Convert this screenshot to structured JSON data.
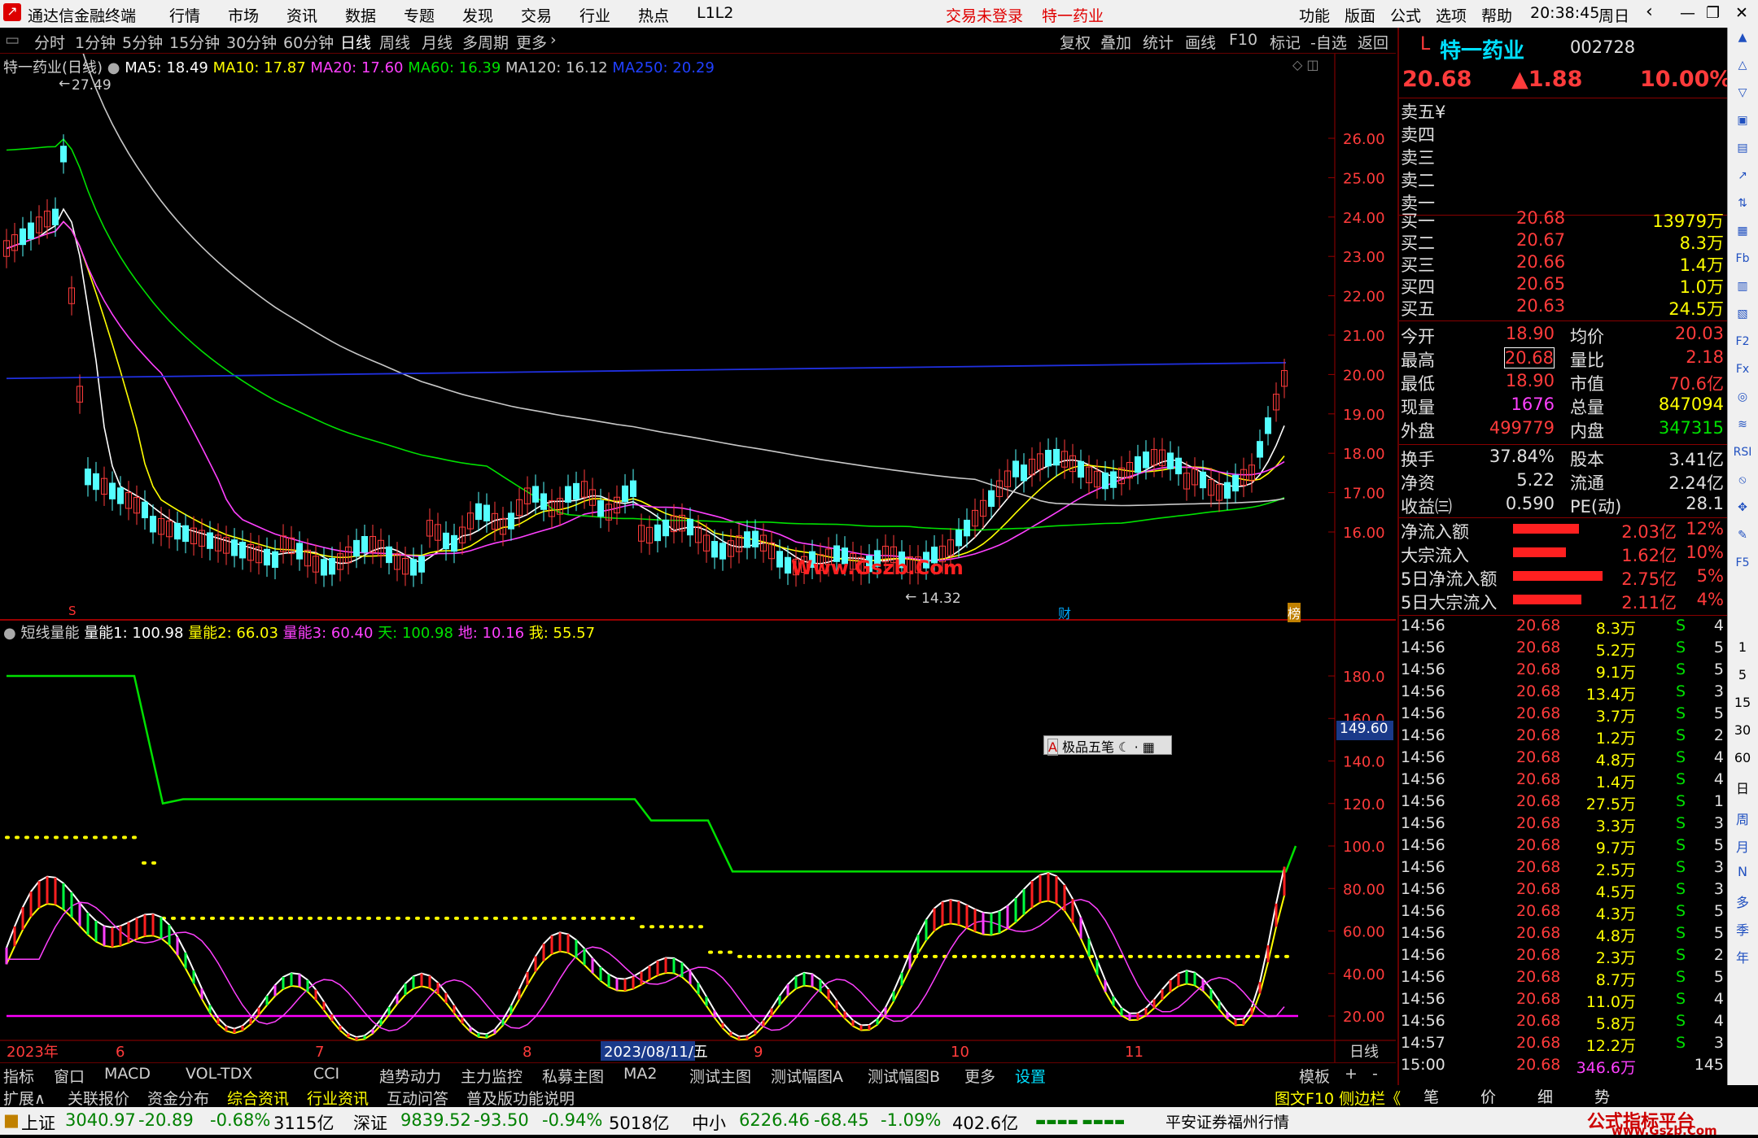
{
  "app": {
    "title": "通达信金融终端",
    "menus": [
      "行情",
      "市场",
      "资讯",
      "数据",
      "专题",
      "发现",
      "交易",
      "行业",
      "热点",
      "L1L2"
    ],
    "login": "交易未登录",
    "stock_title": "特一药业",
    "right_menus": [
      "功能",
      "版面",
      "公式",
      "选项",
      "帮助"
    ],
    "time": "20:38:45",
    "weekday": "周日"
  },
  "periods": [
    "分时",
    "1分钟",
    "5分钟",
    "15分钟",
    "30分钟",
    "60分钟",
    "日线",
    "周线",
    "月线",
    "多周期",
    "更多"
  ],
  "active_period": "日线",
  "tools": [
    "复权",
    "叠加",
    "统计",
    "画线",
    "F10",
    "标记",
    "-自选",
    "返回"
  ],
  "main": {
    "title": "特一药业(日线)",
    "ma": [
      {
        "t": "MA5: 18.49",
        "c": "#ffffff"
      },
      {
        "t": "MA10: 17.87",
        "c": "#ffff00"
      },
      {
        "t": "MA20: 17.60",
        "c": "#ff40ff"
      },
      {
        "t": "MA60: 16.39",
        "c": "#00e000"
      },
      {
        "t": "MA120: 16.12",
        "c": "#c8c8c8"
      },
      {
        "t": "MA250: 20.29",
        "c": "#2040ff"
      }
    ],
    "high_label": "27.49",
    "low_label": "14.32",
    "watermark": "Www.Gszb.Com",
    "fin_mark": "财",
    "bang_mark": "榜",
    "s_mark": "S",
    "yaxis": [
      "26.00",
      "25.00",
      "24.00",
      "23.00",
      "22.00",
      "21.00",
      "20.00",
      "19.00",
      "18.00",
      "17.00",
      "16.00"
    ]
  },
  "sub": {
    "name": "短线量能",
    "items": [
      {
        "t": "量能1: 100.98",
        "c": "#ffffff"
      },
      {
        "t": "量能2: 66.03",
        "c": "#ffff00"
      },
      {
        "t": "量能3: 60.40",
        "c": "#ff40ff"
      },
      {
        "t": "天: 100.98",
        "c": "#00e000"
      },
      {
        "t": "地: 10.16",
        "c": "#ff40ff"
      },
      {
        "t": "我: 55.57",
        "c": "#ffff00"
      }
    ],
    "yaxis": [
      "180.0",
      "160.0",
      "140.0",
      "120.0",
      "100.0",
      "80.00",
      "60.00",
      "40.00",
      "20.00"
    ],
    "cursor_value": "149.60",
    "popup": "极品五笔"
  },
  "xaxis": [
    "2023年",
    "6",
    "7",
    "8",
    "2023/08/11/五",
    "9",
    "10",
    "11"
  ],
  "xaxis_right": "日线",
  "quote": {
    "code": "002728",
    "name": "特一药业",
    "prefix": "L",
    "price": "20.68",
    "change": "▲1.88",
    "pct": "10.00%",
    "sells": [
      {
        "l": "卖五",
        "v": "¥"
      },
      {
        "l": "卖四",
        "v": ""
      },
      {
        "l": "卖三",
        "v": ""
      },
      {
        "l": "卖二",
        "v": ""
      },
      {
        "l": "卖一",
        "v": ""
      }
    ],
    "buys": [
      {
        "l": "买一",
        "p": "20.68",
        "v": "13979万"
      },
      {
        "l": "买二",
        "p": "20.67",
        "v": "8.3万"
      },
      {
        "l": "买三",
        "p": "20.66",
        "v": "1.4万"
      },
      {
        "l": "买四",
        "p": "20.65",
        "v": "1.0万"
      },
      {
        "l": "买五",
        "p": "20.63",
        "v": "24.5万"
      }
    ],
    "stats": [
      [
        "今开",
        "18.90",
        "均价",
        "20.03"
      ],
      [
        "最高",
        "20.68",
        "量比",
        "2.18"
      ],
      [
        "最低",
        "18.90",
        "市值",
        "70.6亿"
      ],
      [
        "现量",
        "1676",
        "总量",
        "847094"
      ],
      [
        "外盘",
        "499779",
        "内盘",
        "347315"
      ]
    ],
    "stats2": [
      [
        "换手",
        "37.84%",
        "股本",
        "3.41亿"
      ],
      [
        "净资",
        "5.22",
        "流通",
        "2.24亿"
      ],
      [
        "收益㈢",
        "0.590",
        "PE(动)",
        "28.1"
      ]
    ],
    "flows": [
      {
        "l": "净流入额",
        "v": "2.03亿",
        "p": "12%",
        "w": 56
      },
      {
        "l": "大宗流入",
        "v": "1.62亿",
        "p": "10%",
        "w": 45
      },
      {
        "l": "5日净流入额",
        "v": "2.75亿",
        "p": "5%",
        "w": 76
      },
      {
        "l": "5日大宗流入",
        "v": "2.11亿",
        "p": "4%",
        "w": 58
      }
    ],
    "ticks": [
      [
        "14:56",
        "20.68",
        "8.3万",
        "S",
        "4"
      ],
      [
        "14:56",
        "20.68",
        "5.2万",
        "S",
        "5"
      ],
      [
        "14:56",
        "20.68",
        "9.1万",
        "S",
        "5"
      ],
      [
        "14:56",
        "20.68",
        "13.4万",
        "S",
        "3"
      ],
      [
        "14:56",
        "20.68",
        "3.7万",
        "S",
        "5"
      ],
      [
        "14:56",
        "20.68",
        "1.2万",
        "S",
        "2"
      ],
      [
        "14:56",
        "20.68",
        "4.8万",
        "S",
        "4"
      ],
      [
        "14:56",
        "20.68",
        "1.4万",
        "S",
        "4"
      ],
      [
        "14:56",
        "20.68",
        "27.5万",
        "S",
        "1"
      ],
      [
        "14:56",
        "20.68",
        "3.3万",
        "S",
        "3"
      ],
      [
        "14:56",
        "20.68",
        "9.7万",
        "S",
        "5"
      ],
      [
        "14:56",
        "20.68",
        "2.5万",
        "S",
        "3"
      ],
      [
        "14:56",
        "20.68",
        "4.5万",
        "S",
        "3"
      ],
      [
        "14:56",
        "20.68",
        "4.3万",
        "S",
        "5"
      ],
      [
        "14:56",
        "20.68",
        "4.8万",
        "S",
        "5"
      ],
      [
        "14:56",
        "20.68",
        "2.3万",
        "S",
        "2"
      ],
      [
        "14:56",
        "20.68",
        "8.7万",
        "S",
        "5"
      ],
      [
        "14:56",
        "20.68",
        "11.0万",
        "S",
        "4"
      ],
      [
        "14:56",
        "20.68",
        "5.8万",
        "S",
        "4"
      ],
      [
        "14:57",
        "20.68",
        "12.2万",
        "S",
        "3"
      ],
      [
        "15:00",
        "20.68",
        "346.6万",
        "",
        "145"
      ]
    ]
  },
  "bottom_tabs1": [
    "指标",
    "窗口",
    "MACD",
    "VOL-TDX",
    "CCI",
    "趋势动力",
    "主力监控",
    "私募主图",
    "MA2",
    "测试主图",
    "测试幅图A",
    "测试幅图B",
    "更多",
    "设置"
  ],
  "bottom_tabs1_right": [
    "模板",
    "+",
    "-"
  ],
  "bottom_tabs2": [
    "扩展∧",
    "关联报价",
    "资金分布",
    "综合资讯",
    "行业资讯",
    "互动问答",
    "普及版功能说明"
  ],
  "bottom_tabs2_right": "图文F10 侧边栏《",
  "panel_tabs": [
    "笔",
    "价",
    "细",
    "势"
  ],
  "status": [
    {
      "n": "上证",
      "v": "3040.97",
      "c": "-20.89",
      "p": "-0.68%",
      "a": "3115亿"
    },
    {
      "n": "深证",
      "v": "9839.52",
      "c": "-93.50",
      "p": "-0.94%",
      "a": "5018亿"
    },
    {
      "n": "中小",
      "v": "6226.46",
      "c": "-68.45",
      "p": "-1.09%",
      "a": "402.6亿"
    }
  ],
  "status_broker": "平安证券福州行情",
  "status_logo": "公式指标平台",
  "status_url": "www.Gszb.Com",
  "sidebar": [
    "周",
    "月",
    "N",
    "多",
    "季",
    "年"
  ],
  "sidebar_nums": [
    "1",
    "5",
    "15",
    "30",
    "60",
    "日"
  ]
}
